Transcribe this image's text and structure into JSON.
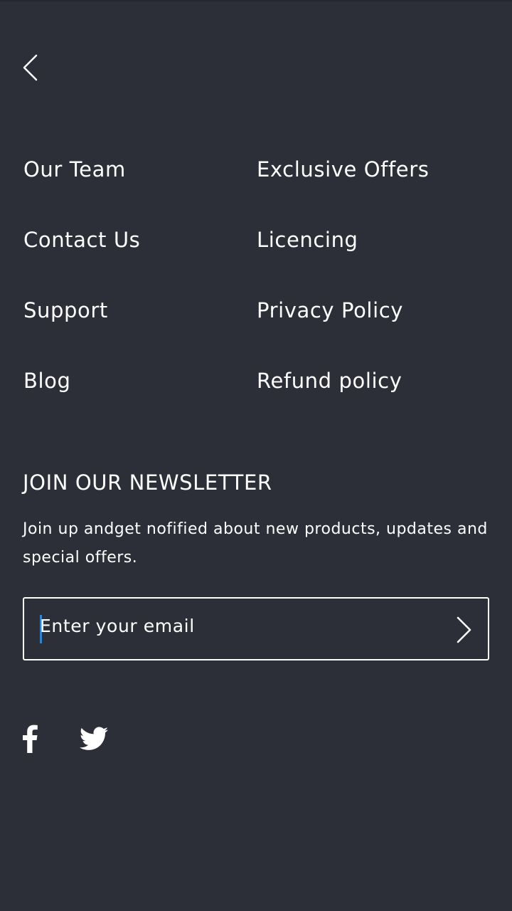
{
  "nav": {
    "back_icon": "chevron-left-icon"
  },
  "links": [
    {
      "label": "Our Team"
    },
    {
      "label": "Exclusive Offers"
    },
    {
      "label": "Contact Us"
    },
    {
      "label": "Licencing"
    },
    {
      "label": "Support"
    },
    {
      "label": "Privacy Policy"
    },
    {
      "label": "Blog"
    },
    {
      "label": "Refund policy"
    }
  ],
  "newsletter": {
    "title": "JOIN OUR NEWSLETTER",
    "description": "Join up andget nofified about new products, updates and special offers.",
    "email_placeholder": "Enter your email",
    "email_value": "",
    "submit_icon": "chevron-right-icon"
  },
  "social": [
    {
      "name": "facebook",
      "icon": "facebook-icon"
    },
    {
      "name": "twitter",
      "icon": "twitter-icon"
    }
  ],
  "colors": {
    "background": "#2c2f38",
    "text": "#ffffff",
    "caret": "#1e88e5"
  }
}
